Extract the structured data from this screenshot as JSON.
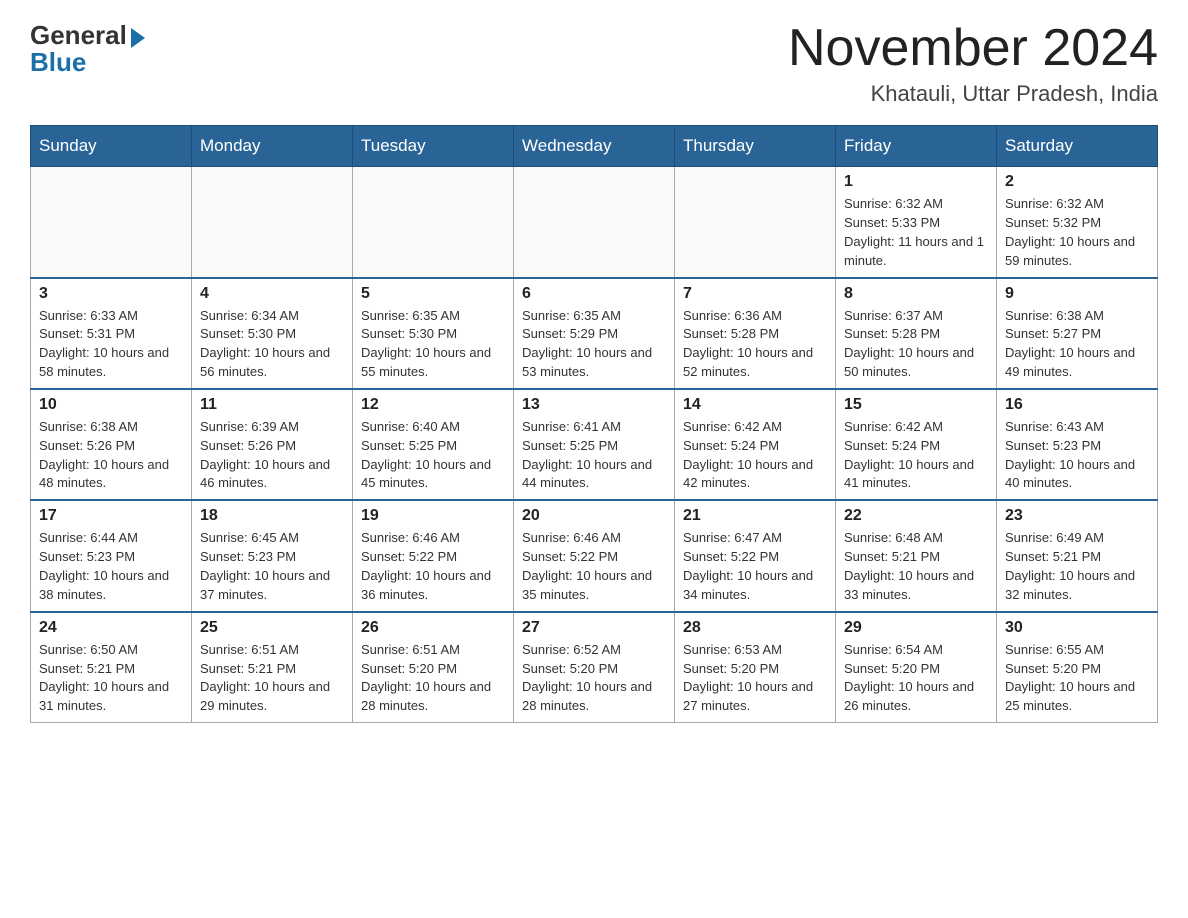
{
  "header": {
    "logo_general": "General",
    "logo_blue": "Blue",
    "month_title": "November 2024",
    "location": "Khatauli, Uttar Pradesh, India"
  },
  "weekdays": [
    "Sunday",
    "Monday",
    "Tuesday",
    "Wednesday",
    "Thursday",
    "Friday",
    "Saturday"
  ],
  "weeks": [
    [
      {
        "day": "",
        "info": ""
      },
      {
        "day": "",
        "info": ""
      },
      {
        "day": "",
        "info": ""
      },
      {
        "day": "",
        "info": ""
      },
      {
        "day": "",
        "info": ""
      },
      {
        "day": "1",
        "info": "Sunrise: 6:32 AM\nSunset: 5:33 PM\nDaylight: 11 hours\nand 1 minute."
      },
      {
        "day": "2",
        "info": "Sunrise: 6:32 AM\nSunset: 5:32 PM\nDaylight: 10 hours\nand 59 minutes."
      }
    ],
    [
      {
        "day": "3",
        "info": "Sunrise: 6:33 AM\nSunset: 5:31 PM\nDaylight: 10 hours\nand 58 minutes."
      },
      {
        "day": "4",
        "info": "Sunrise: 6:34 AM\nSunset: 5:30 PM\nDaylight: 10 hours\nand 56 minutes."
      },
      {
        "day": "5",
        "info": "Sunrise: 6:35 AM\nSunset: 5:30 PM\nDaylight: 10 hours\nand 55 minutes."
      },
      {
        "day": "6",
        "info": "Sunrise: 6:35 AM\nSunset: 5:29 PM\nDaylight: 10 hours\nand 53 minutes."
      },
      {
        "day": "7",
        "info": "Sunrise: 6:36 AM\nSunset: 5:28 PM\nDaylight: 10 hours\nand 52 minutes."
      },
      {
        "day": "8",
        "info": "Sunrise: 6:37 AM\nSunset: 5:28 PM\nDaylight: 10 hours\nand 50 minutes."
      },
      {
        "day": "9",
        "info": "Sunrise: 6:38 AM\nSunset: 5:27 PM\nDaylight: 10 hours\nand 49 minutes."
      }
    ],
    [
      {
        "day": "10",
        "info": "Sunrise: 6:38 AM\nSunset: 5:26 PM\nDaylight: 10 hours\nand 48 minutes."
      },
      {
        "day": "11",
        "info": "Sunrise: 6:39 AM\nSunset: 5:26 PM\nDaylight: 10 hours\nand 46 minutes."
      },
      {
        "day": "12",
        "info": "Sunrise: 6:40 AM\nSunset: 5:25 PM\nDaylight: 10 hours\nand 45 minutes."
      },
      {
        "day": "13",
        "info": "Sunrise: 6:41 AM\nSunset: 5:25 PM\nDaylight: 10 hours\nand 44 minutes."
      },
      {
        "day": "14",
        "info": "Sunrise: 6:42 AM\nSunset: 5:24 PM\nDaylight: 10 hours\nand 42 minutes."
      },
      {
        "day": "15",
        "info": "Sunrise: 6:42 AM\nSunset: 5:24 PM\nDaylight: 10 hours\nand 41 minutes."
      },
      {
        "day": "16",
        "info": "Sunrise: 6:43 AM\nSunset: 5:23 PM\nDaylight: 10 hours\nand 40 minutes."
      }
    ],
    [
      {
        "day": "17",
        "info": "Sunrise: 6:44 AM\nSunset: 5:23 PM\nDaylight: 10 hours\nand 38 minutes."
      },
      {
        "day": "18",
        "info": "Sunrise: 6:45 AM\nSunset: 5:23 PM\nDaylight: 10 hours\nand 37 minutes."
      },
      {
        "day": "19",
        "info": "Sunrise: 6:46 AM\nSunset: 5:22 PM\nDaylight: 10 hours\nand 36 minutes."
      },
      {
        "day": "20",
        "info": "Sunrise: 6:46 AM\nSunset: 5:22 PM\nDaylight: 10 hours\nand 35 minutes."
      },
      {
        "day": "21",
        "info": "Sunrise: 6:47 AM\nSunset: 5:22 PM\nDaylight: 10 hours\nand 34 minutes."
      },
      {
        "day": "22",
        "info": "Sunrise: 6:48 AM\nSunset: 5:21 PM\nDaylight: 10 hours\nand 33 minutes."
      },
      {
        "day": "23",
        "info": "Sunrise: 6:49 AM\nSunset: 5:21 PM\nDaylight: 10 hours\nand 32 minutes."
      }
    ],
    [
      {
        "day": "24",
        "info": "Sunrise: 6:50 AM\nSunset: 5:21 PM\nDaylight: 10 hours\nand 31 minutes."
      },
      {
        "day": "25",
        "info": "Sunrise: 6:51 AM\nSunset: 5:21 PM\nDaylight: 10 hours\nand 29 minutes."
      },
      {
        "day": "26",
        "info": "Sunrise: 6:51 AM\nSunset: 5:20 PM\nDaylight: 10 hours\nand 28 minutes."
      },
      {
        "day": "27",
        "info": "Sunrise: 6:52 AM\nSunset: 5:20 PM\nDaylight: 10 hours\nand 28 minutes."
      },
      {
        "day": "28",
        "info": "Sunrise: 6:53 AM\nSunset: 5:20 PM\nDaylight: 10 hours\nand 27 minutes."
      },
      {
        "day": "29",
        "info": "Sunrise: 6:54 AM\nSunset: 5:20 PM\nDaylight: 10 hours\nand 26 minutes."
      },
      {
        "day": "30",
        "info": "Sunrise: 6:55 AM\nSunset: 5:20 PM\nDaylight: 10 hours\nand 25 minutes."
      }
    ]
  ]
}
